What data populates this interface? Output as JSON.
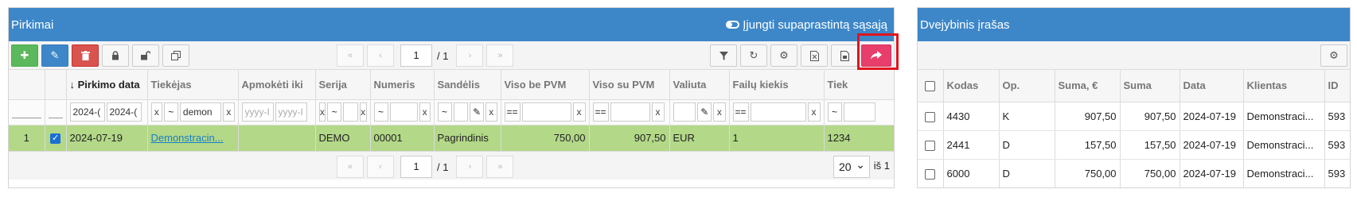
{
  "left": {
    "title": "Pirkimai",
    "toggle_label": "Įjungti supaprastintą sąsają",
    "pager": {
      "page": "1",
      "total": "/ 1"
    },
    "columns": [
      "",
      "",
      "Pirkimo data",
      "Tiekėjas",
      "Apmokėti iki",
      "Serija",
      "Numeris",
      "Sandėlis",
      "Viso be PVM",
      "Viso su PVM",
      "Valiuta",
      "Failų kiekis",
      "Tiek"
    ],
    "sort_indicator": "↓",
    "filters": {
      "date_from": "2024-(",
      "date_to": "2024-(",
      "supplier_op": "~",
      "supplier_value": "demon",
      "due_from_placeholder": "yyyy-I",
      "due_to_placeholder": "yyyy-I",
      "series_op": "~",
      "number_op": "~",
      "warehouse_op": "~",
      "net_op": "==",
      "gross_op": "==",
      "files_op": "==",
      "last_op": "~",
      "clear": "x"
    },
    "rows": [
      {
        "index": "1",
        "checked": true,
        "date": "2024-07-19",
        "supplier": "Demonstracin...",
        "due": "",
        "series": "DEMO",
        "number": "00001",
        "warehouse": "Pagrindinis",
        "net": "750,00",
        "gross": "907,50",
        "currency": "EUR",
        "files": "1",
        "last": "1234"
      }
    ],
    "page_size": "20",
    "of_label": "iš 1",
    "highlight_color": "#e0141e"
  },
  "right": {
    "title": "Dvejybinis įrašas",
    "columns": [
      "",
      "Kodas",
      "Op.",
      "Suma, €",
      "Suma",
      "Data",
      "Klientas",
      "ID"
    ],
    "rows": [
      {
        "code": "4430",
        "op": "K",
        "sum_eur": "907,50",
        "sum": "907,50",
        "date": "2024-07-19",
        "client": "Demonstraci...",
        "id": "593"
      },
      {
        "code": "2441",
        "op": "D",
        "sum_eur": "157,50",
        "sum": "157,50",
        "date": "2024-07-19",
        "client": "Demonstraci...",
        "id": "593"
      },
      {
        "code": "6000",
        "op": "D",
        "sum_eur": "750,00",
        "sum": "750,00",
        "date": "2024-07-19",
        "client": "Demonstraci...",
        "id": "593"
      }
    ]
  },
  "icons": {
    "add": "plus-icon",
    "edit": "pencil-icon",
    "delete": "trash-icon",
    "lock": "lock-icon",
    "unlock": "unlock-icon",
    "copy": "copy-icon",
    "filter": "filter-icon",
    "refresh": "refresh-icon",
    "settings": "gear-icon",
    "excel": "excel-export-icon",
    "pdf": "pdf-export-icon",
    "forward": "share-forward-icon"
  },
  "colors": {
    "header": "#3d87c9",
    "add": "#5cb85c",
    "edit": "#3d87c9",
    "delete": "#d9534f",
    "forward": "#e83e6c",
    "selected_row": "#b3d888"
  }
}
